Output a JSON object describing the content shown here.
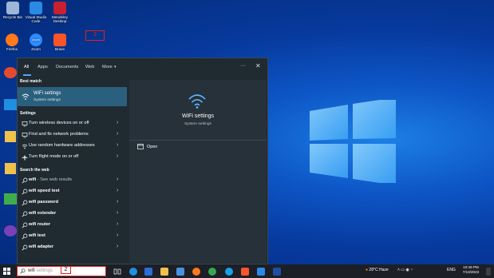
{
  "desktop": {
    "icons": [
      {
        "name": "recycle-bin-icon",
        "label": "Recycle Bin",
        "color": "#9fb7d6"
      },
      {
        "name": "vscode-icon",
        "label": "Visual Studio Code",
        "color": "#2b8ae6"
      },
      {
        "name": "mendeley-icon",
        "label": "Mendeley Desktop",
        "color": "#c8202e"
      },
      {
        "name": "firefox-icon",
        "label": "Firefox",
        "color": "#ff7a1a"
      },
      {
        "name": "zoom-icon",
        "label": "Zoom",
        "color": "#2d8cff"
      },
      {
        "name": "brave-icon",
        "label": "Brave",
        "color": "#fb542b"
      }
    ],
    "zoom_glyph": "zoom"
  },
  "search_panel": {
    "tabs": [
      "All",
      "Apps",
      "Documents",
      "Web",
      "More"
    ],
    "more_arrow": "▾",
    "ellipsis": "···",
    "close": "✕",
    "best_match_heading": "Best match",
    "best_match": {
      "title": "WiFi settings",
      "subtitle": "System settings"
    },
    "annotation_3": "3",
    "settings_heading": "Settings",
    "settings_items": [
      "Turn wireless devices on or off",
      "Find and fix network problems",
      "Use random hardware addresses",
      "Turn flight mode on or off"
    ],
    "web_heading": "Search the web",
    "web_first": {
      "bold": "wifi",
      "rest": " - See web results"
    },
    "web_items": [
      "wifi speed test",
      "wifi password",
      "wifi extender",
      "wifi router",
      "wifi test",
      "wifi adapter"
    ],
    "chevron": "›",
    "preview": {
      "title": "WiFi settings",
      "subtitle": "System settings",
      "open_label": "Open"
    }
  },
  "taskbar": {
    "search_typed": "wifi",
    "search_ghost": " settings",
    "annotation_2": "2",
    "weather": "28°C  Haze",
    "language": "ENG",
    "time": "10:46 PM",
    "date": "7/13/2023",
    "colors": {
      "accent": "#2b5f7e",
      "annotation": "#e02020"
    }
  }
}
